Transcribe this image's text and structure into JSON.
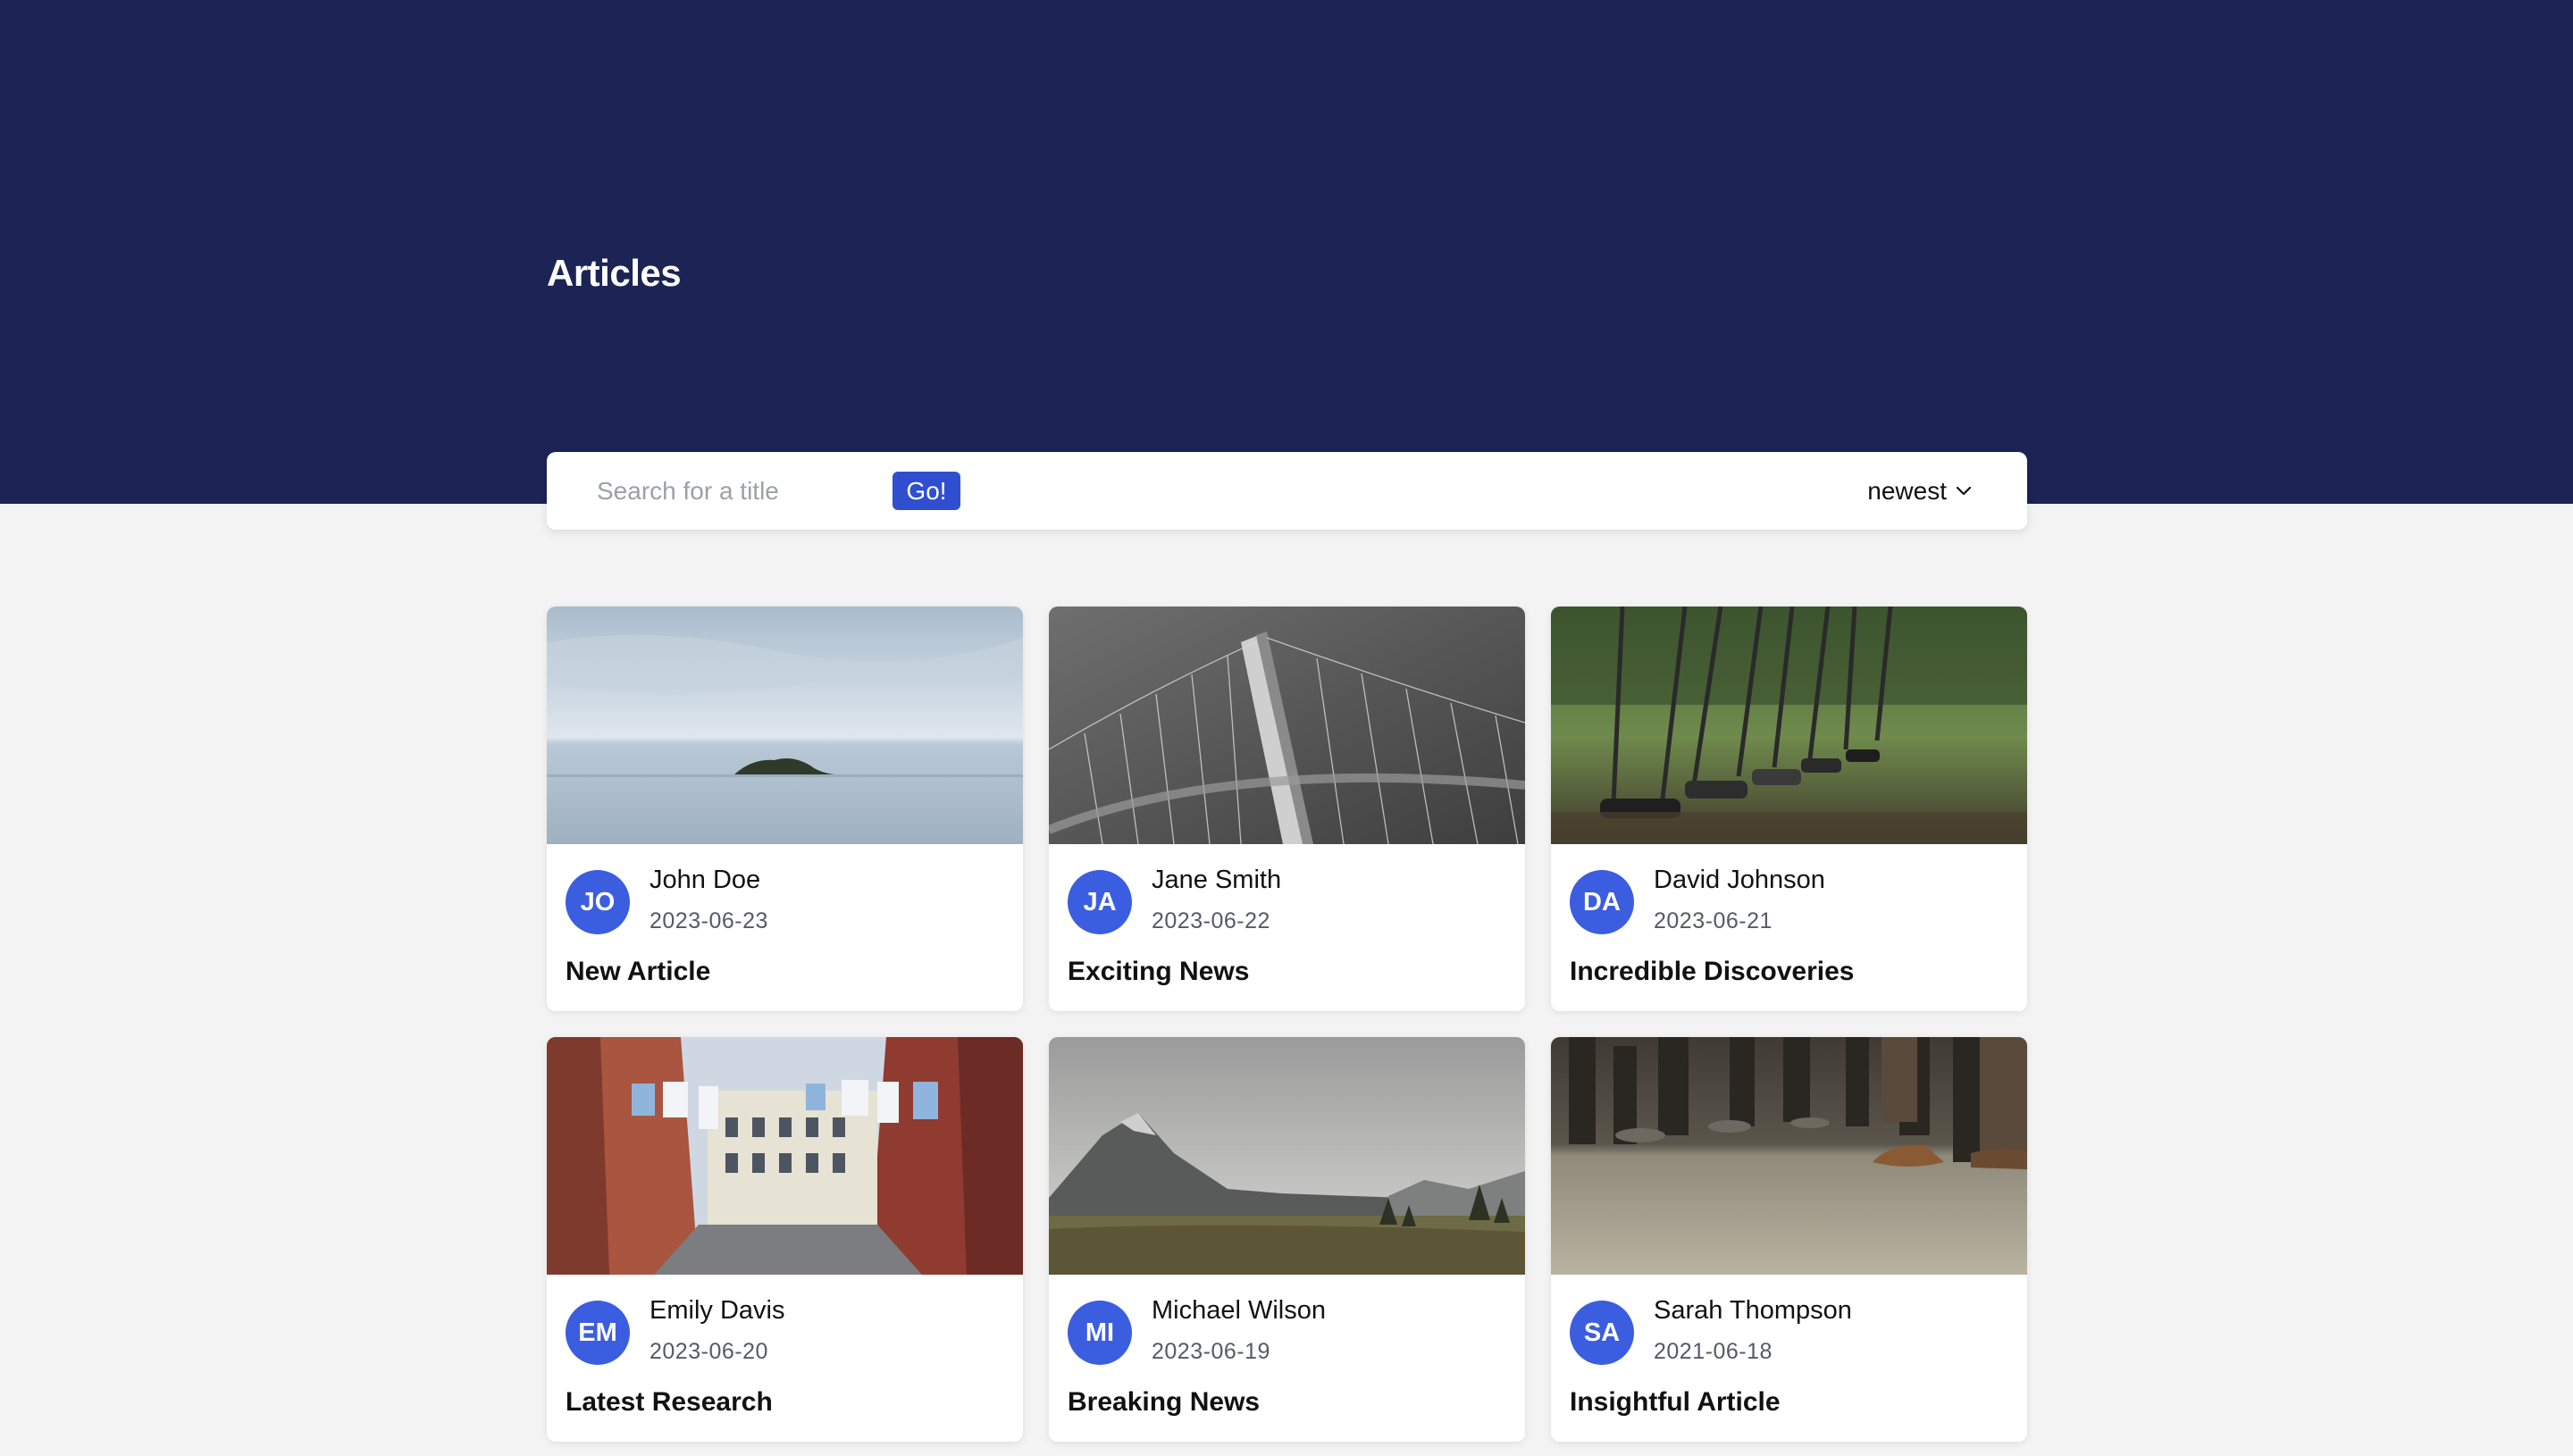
{
  "header": {
    "title": "Articles"
  },
  "colors": {
    "hero": "#1b2454",
    "accent": "#2f4fd0",
    "avatar": "#3b5ddf",
    "background": "#f3f3f3"
  },
  "toolbar": {
    "search_placeholder": "Search for a title",
    "go_label": "Go!",
    "sort_value": "newest",
    "sort_icon": "chevron-down-icon"
  },
  "articles": [
    {
      "initials": "JO",
      "author": "John Doe",
      "date": "2023-06-23",
      "title": "New Article",
      "image": "sea-island-photo"
    },
    {
      "initials": "JA",
      "author": "Jane Smith",
      "date": "2023-06-22",
      "title": "Exciting News",
      "image": "bridge-photo"
    },
    {
      "initials": "DA",
      "author": "David Johnson",
      "date": "2023-06-21",
      "title": "Incredible Discoveries",
      "image": "swings-photo"
    },
    {
      "initials": "EM",
      "author": "Emily Davis",
      "date": "2023-06-20",
      "title": "Latest Research",
      "image": "street-laundry-photo"
    },
    {
      "initials": "MI",
      "author": "Michael Wilson",
      "date": "2023-06-19",
      "title": "Breaking News",
      "image": "mountain-valley-photo"
    },
    {
      "initials": "SA",
      "author": "Sarah Thompson",
      "date": "2021-06-18",
      "title": "Insightful Article",
      "image": "subway-feet-photo"
    }
  ]
}
